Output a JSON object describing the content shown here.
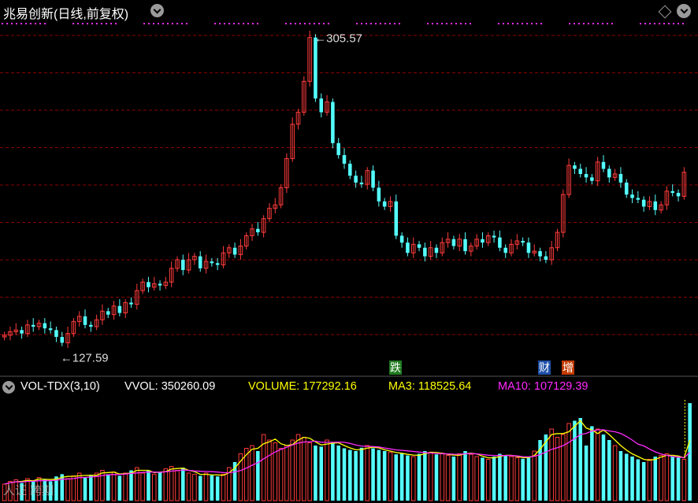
{
  "header": {
    "title": "兆易创新(日线,前复权)"
  },
  "indicator": {
    "name": "VOL-TDX(3,10)",
    "vvol": "VVOL: 350260.09",
    "volume": "VOLUME: 177292.16",
    "ma3": "MA3: 118525.64",
    "ma10": "MA10: 107129.39"
  },
  "markers": {
    "high_label": "305.57",
    "low_label": "127.59",
    "badge_fall": "跌",
    "badge_finance": "财",
    "badge_increase": "增"
  },
  "watermark": "人证 跨期",
  "colors": {
    "up": "#ff3b3b",
    "down": "#54ffff",
    "ma3": "#ffff00",
    "ma10": "#ff2aff",
    "grid": "#8b0000",
    "dots": "#ff2aff"
  },
  "chart_data": {
    "type": "candlestick",
    "y_high": 305.57,
    "y_low": 127.59,
    "series": [
      {
        "name": "price_close",
        "values": [
          132,
          134,
          135,
          133,
          138,
          137,
          139,
          136,
          135,
          131,
          127.59,
          133,
          140,
          143,
          138,
          137,
          141,
          146,
          144,
          149,
          145,
          151,
          150,
          158,
          163,
          160,
          162,
          161,
          163,
          171,
          176,
          170,
          176,
          178,
          171,
          175,
          174,
          173,
          180,
          183,
          179,
          184,
          190,
          194,
          192,
          200,
          206,
          208,
          218,
          235,
          255,
          262,
          280,
          305.57,
          270,
          262,
          268,
          244,
          237,
          232,
          225,
          221,
          220,
          228,
          218,
          210,
          207,
          210,
          190,
          186,
          180,
          185,
          183,
          178,
          183,
          180,
          186,
          188,
          184,
          188,
          181,
          184,
          188,
          186,
          190,
          189,
          183,
          180,
          185,
          187,
          186,
          180,
          181,
          178,
          176,
          183,
          192,
          214,
          231,
          229,
          226,
          224,
          222,
          233,
          229,
          224,
          226,
          221,
          214,
          212,
          211,
          207,
          210,
          205,
          208,
          216,
          215,
          213,
          227
        ]
      },
      {
        "name": "volume",
        "values": [
          30,
          35,
          38,
          32,
          40,
          36,
          42,
          38,
          35,
          44,
          48,
          40,
          45,
          50,
          42,
          46,
          50,
          55,
          48,
          52,
          45,
          50,
          55,
          60,
          50,
          55,
          48,
          52,
          58,
          62,
          55,
          60,
          50,
          48,
          45,
          50,
          46,
          44,
          48,
          60,
          70,
          85,
          95,
          100,
          90,
          120,
          110,
          105,
          95,
          100,
          110,
          120,
          115,
          105,
          100,
          98,
          110,
          105,
          100,
          95,
          92,
          90,
          96,
          100,
          95,
          92,
          90,
          88,
          84,
          86,
          82,
          80,
          85,
          90,
          88,
          84,
          86,
          82,
          80,
          85,
          90,
          84,
          80,
          78,
          75,
          80,
          85,
          82,
          80,
          78,
          76,
          80,
          90,
          110,
          120,
          130,
          115,
          120,
          140,
          145,
          150,
          100,
          135,
          130,
          120,
          110,
          100,
          90,
          85,
          80,
          75,
          70,
          75,
          80,
          82,
          85,
          80,
          78,
          75,
          177
        ]
      }
    ]
  }
}
